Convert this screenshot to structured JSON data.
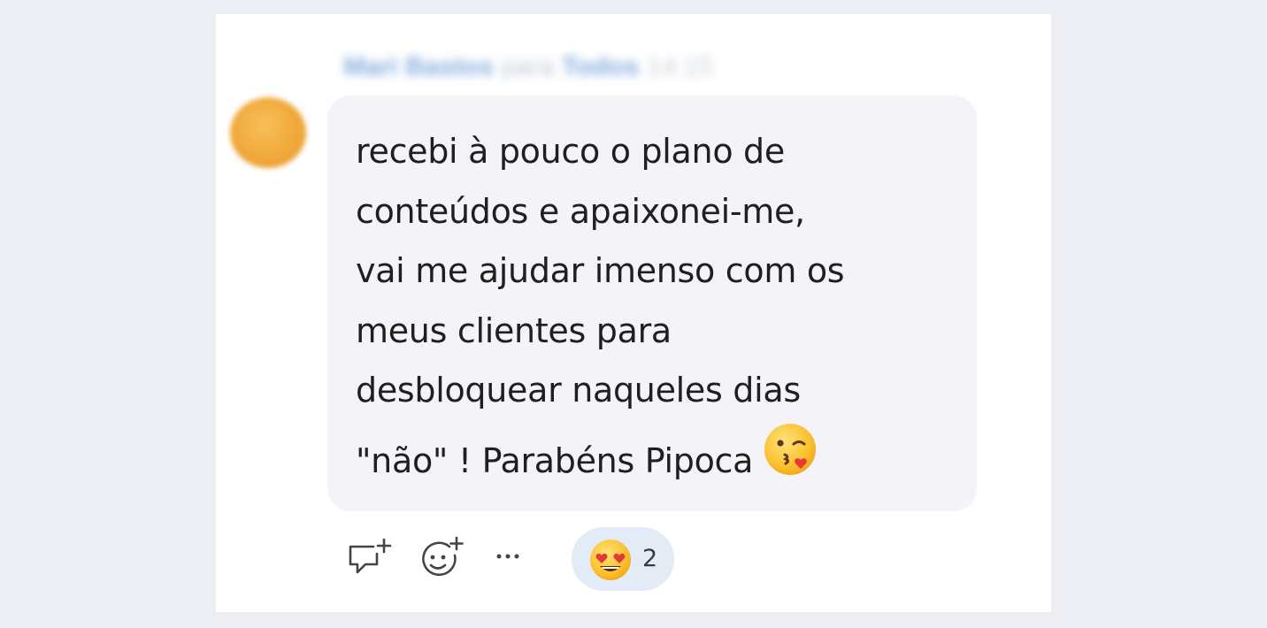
{
  "post": {
    "author": "Mari Bastos",
    "audience_prefix": "para",
    "audience": "Todos",
    "time": "14:15",
    "message_lines": [
      "recebi à pouco o plano de",
      "conteúdos e apaixonei-me,",
      "vai me ajudar imenso com os",
      "meus clientes para",
      "desbloquear naqueles dias",
      "\"não\" ! Parabéns Pipoca"
    ],
    "trailing_emoji": "face-blowing-kiss-icon"
  },
  "actions": {
    "reply_icon": "reply-icon",
    "add_reaction_icon": "add-reaction-icon",
    "more_icon": "more-options-icon",
    "reaction": {
      "emoji": "heart-eyes-icon",
      "count": "2"
    }
  },
  "colors": {
    "background": "#eceef3",
    "card": "#ffffff",
    "bubble": "#f3f3f8",
    "text": "#1f1f1f",
    "header_blurred": "#6fa0d8",
    "reaction_pill": "#e3ecf6",
    "avatar": "#f0a83a"
  }
}
